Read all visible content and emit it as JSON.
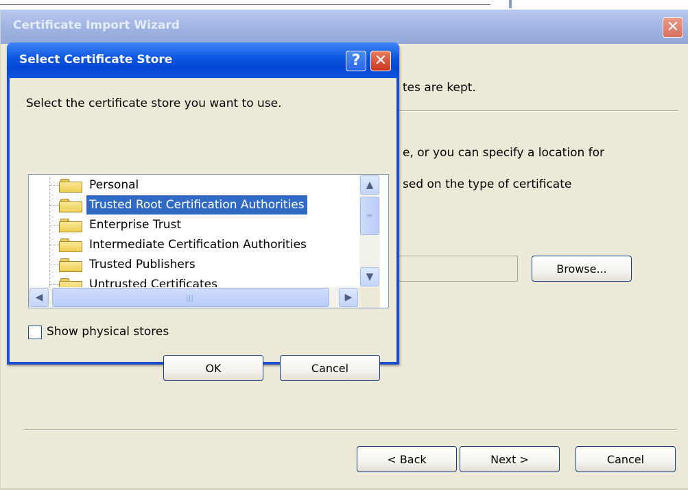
{
  "wizard": {
    "title": "Certificate Import Wizard",
    "close_glyph": "✕",
    "text_line1": "tes are kept.",
    "text_line2": "e, or you can specify a location for",
    "text_line3": "sed on the type of certificate",
    "browse_label": "Browse...",
    "back_label": "< Back",
    "next_label": "Next >",
    "cancel_label": "Cancel"
  },
  "dialog": {
    "title": "Select Certificate Store",
    "help_glyph": "?",
    "close_glyph": "✕",
    "prompt": "Select the certificate store you want to use.",
    "stores": [
      "Personal",
      "Trusted Root Certification Authorities",
      "Enterprise Trust",
      "Intermediate Certification Authorities",
      "Trusted Publishers",
      "Untrusted Certificates"
    ],
    "selected_store": "Trusted Root Certification Authorities",
    "show_physical_label": "Show physical stores",
    "show_physical_checked": false,
    "ok_label": "OK",
    "cancel_label": "Cancel"
  },
  "colors": {
    "dialog_title_blue": "#0a55e0",
    "selection_blue": "#316ac5",
    "window_face": "#ece9d8",
    "wizard_title_inactive": "#9fb3e2"
  },
  "icons": [
    "folder-icon",
    "help-icon",
    "close-icon",
    "scroll-up-icon",
    "scroll-down-icon",
    "scroll-left-icon",
    "scroll-right-icon"
  ]
}
